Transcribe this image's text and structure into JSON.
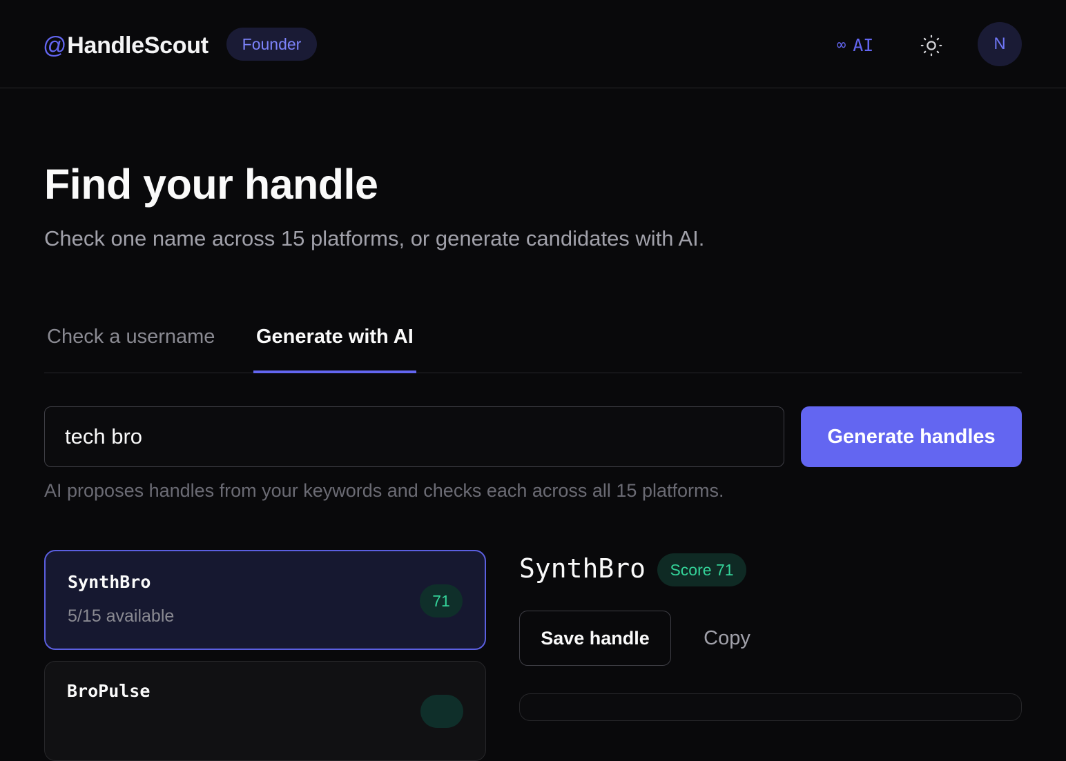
{
  "header": {
    "brand_at": "@",
    "brand_name": "HandleScout",
    "plan_badge": "Founder",
    "ai_symbol": "∞",
    "ai_label": "AI",
    "theme_icon": "sun-icon",
    "avatar_initial": "N"
  },
  "hero": {
    "title": "Find your handle",
    "subtitle": "Check one name across 15 platforms, or generate candidates with AI."
  },
  "tabs": [
    {
      "label": "Check a username",
      "active": false
    },
    {
      "label": "Generate with AI",
      "active": true
    }
  ],
  "generator": {
    "input_value": "tech bro",
    "button_label": "Generate handles",
    "helper": "AI proposes handles from your keywords and checks each across all 15 platforms."
  },
  "candidates": [
    {
      "name": "SynthBro",
      "availability": "5/15 available",
      "score": "71",
      "selected": true
    },
    {
      "name": "BroPulse",
      "availability": "",
      "score": "",
      "selected": false
    }
  ],
  "detail": {
    "name": "SynthBro",
    "score_label": "Score 71",
    "save_label": "Save handle",
    "copy_label": "Copy"
  },
  "colors": {
    "accent": "#6366f1",
    "background": "#09090b",
    "success": "#34d399"
  }
}
